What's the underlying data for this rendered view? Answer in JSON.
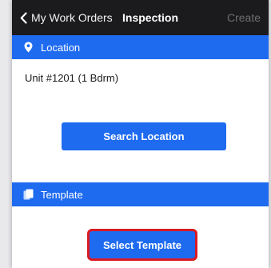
{
  "navbar": {
    "back_label": "My Work Orders",
    "title": "Inspection",
    "create_label": "Create"
  },
  "location_section": {
    "icon": "location-pin-icon",
    "header": "Location",
    "value": "Unit #1201 (1 Bdrm)",
    "search_button_label": "Search Location"
  },
  "template_section": {
    "icon": "document-icon",
    "header": "Template",
    "select_button_label": "Select Template"
  },
  "colors": {
    "accent": "#1f6bf0",
    "navbar_bg": "#1b1b1d",
    "highlight": "#d91a23"
  }
}
